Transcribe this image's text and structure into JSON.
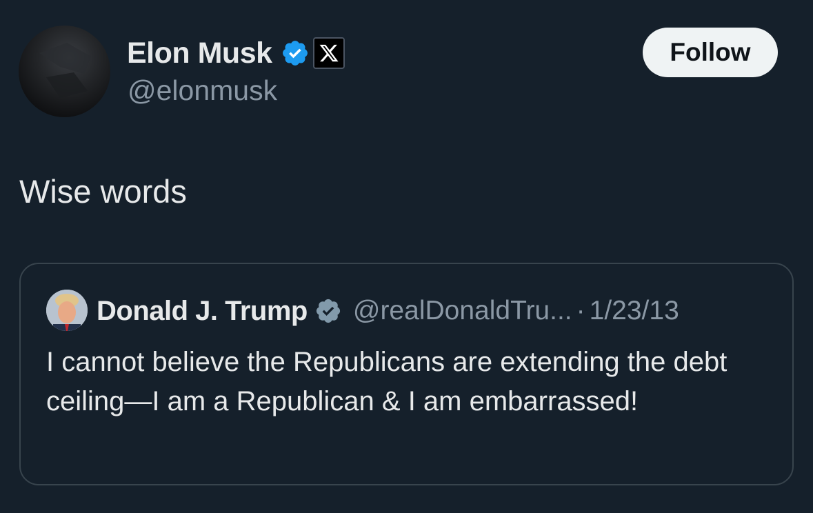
{
  "post": {
    "author": {
      "name": "Elon Musk",
      "handle": "@elonmusk",
      "verified_icon": "verified-badge-icon",
      "affiliation_icon": "x-logo-icon"
    },
    "follow_label": "Follow",
    "text": "Wise words"
  },
  "quoted_post": {
    "author": {
      "name": "Donald J. Trump",
      "handle": "@realDonaldTru...",
      "verified_icon": "verified-badge-icon"
    },
    "separator": "·",
    "date": "1/23/13",
    "text": "I cannot believe the Republicans are extending the debt ceiling—I am a Republican & I am embarrassed!"
  },
  "colors": {
    "background": "#15202b",
    "verified_blue": "#1d9bf0",
    "verified_gray": "#829aab",
    "secondary_text": "#8b98a5",
    "follow_button": "#eff3f4",
    "card_border": "#38444d"
  }
}
